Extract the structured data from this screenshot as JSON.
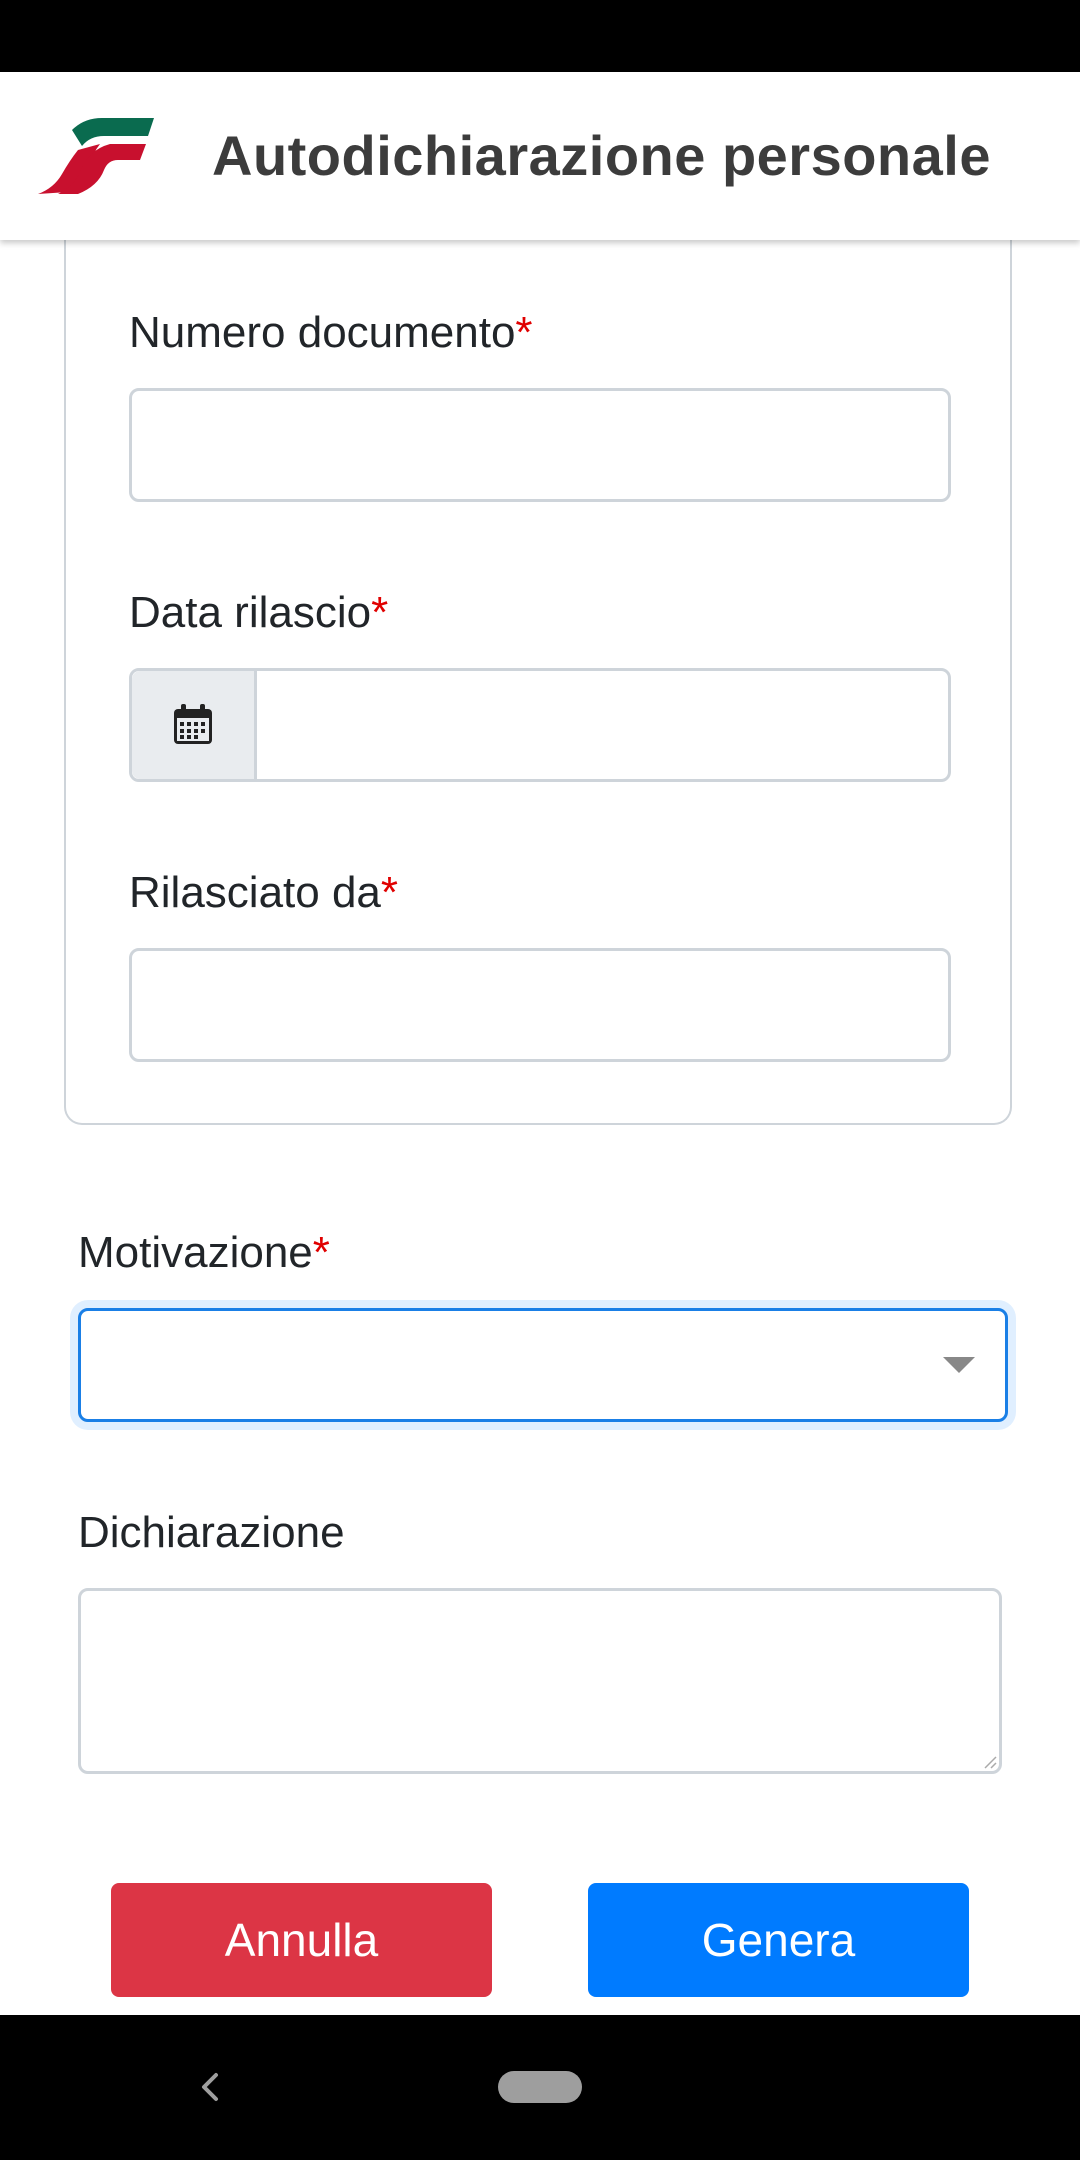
{
  "header": {
    "title": "Autodichiarazione personale",
    "logo_icon": "fs-logo"
  },
  "document_section": {
    "numero_documento": {
      "label": "Numero documento",
      "required_mark": "*",
      "value": ""
    },
    "data_rilascio": {
      "label": "Data rilascio",
      "required_mark": "*",
      "value": "",
      "icon": "calendar-icon"
    },
    "rilasciato_da": {
      "label": "Rilasciato da",
      "required_mark": "*",
      "value": ""
    }
  },
  "motivazione": {
    "label": "Motivazione",
    "required_mark": "*",
    "selected": ""
  },
  "dichiarazione": {
    "label": "Dichiarazione",
    "value": ""
  },
  "actions": {
    "cancel_label": "Annulla",
    "generate_label": "Genera"
  },
  "colors": {
    "cancel": "#dc3545",
    "generate": "#007bff",
    "required": "#e00000",
    "logo_green": "#0a6b4f",
    "logo_red": "#c8102e",
    "focus": "#1a7fe6"
  }
}
